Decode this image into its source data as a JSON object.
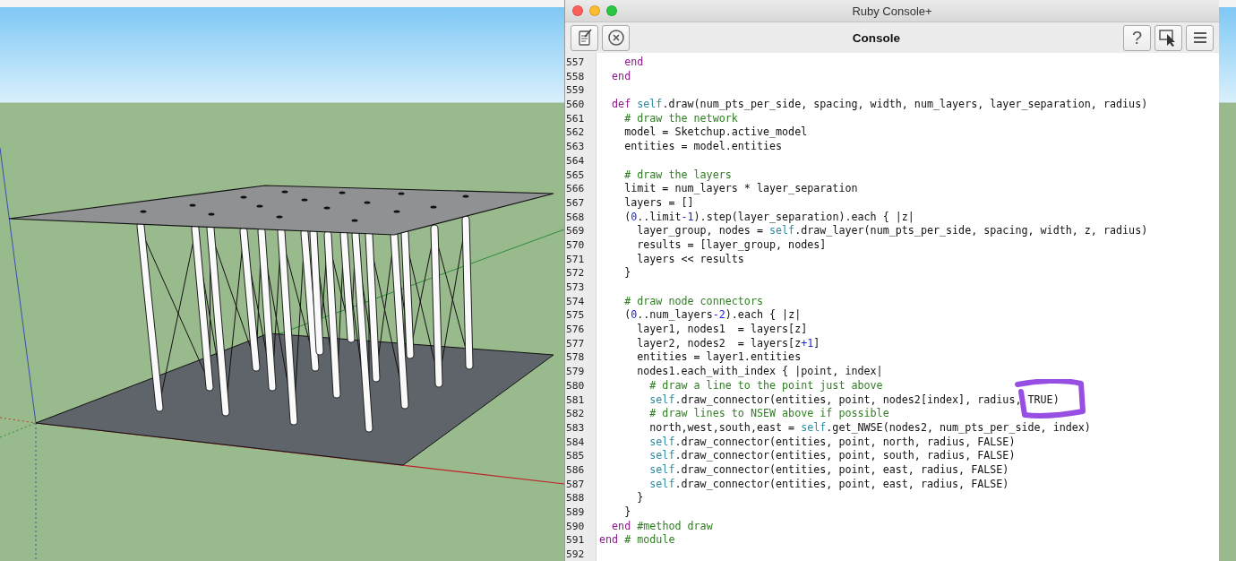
{
  "window": {
    "title": "Ruby Console+"
  },
  "toolbar": {
    "title": "Console",
    "help": "?"
  },
  "code": [
    {
      "number": "557",
      "tokens": [
        {
          "kind": "keyword",
          "text": "    end"
        }
      ]
    },
    {
      "number": "558",
      "tokens": [
        {
          "kind": "keyword",
          "text": "  end"
        }
      ]
    },
    {
      "number": "559"
    },
    {
      "number": "560",
      "tokens": [
        {
          "kind": "keyword",
          "text": "  def "
        },
        {
          "kind": "self",
          "text": "self"
        },
        {
          "kind": "plain",
          "text": ".draw(num_pts_per_side, spacing, width, num_layers, layer_separation, radius)"
        }
      ]
    },
    {
      "number": "561",
      "tokens": [
        {
          "kind": "comment",
          "text": "    # draw the network"
        }
      ]
    },
    {
      "number": "562",
      "tokens": [
        {
          "kind": "plain",
          "text": "    model = Sketchup.active_model"
        }
      ]
    },
    {
      "number": "563",
      "tokens": [
        {
          "kind": "plain",
          "text": "    entities = model.entities"
        }
      ]
    },
    {
      "number": "564"
    },
    {
      "number": "565",
      "tokens": [
        {
          "kind": "comment",
          "text": "    # draw the layers"
        }
      ]
    },
    {
      "number": "566",
      "tokens": [
        {
          "kind": "plain",
          "text": "    limit = num_layers * layer_separation"
        }
      ]
    },
    {
      "number": "567",
      "tokens": [
        {
          "kind": "plain",
          "text": "    layers = []"
        }
      ]
    },
    {
      "number": "568",
      "tokens": [
        {
          "kind": "plain",
          "text": "    ("
        },
        {
          "kind": "number",
          "text": "0"
        },
        {
          "kind": "plain",
          "text": "..limit"
        },
        {
          "kind": "number",
          "text": "-1"
        },
        {
          "kind": "plain",
          "text": ").step(layer_separation).each { |z|"
        }
      ]
    },
    {
      "number": "569",
      "tokens": [
        {
          "kind": "plain",
          "text": "      layer_group, nodes = "
        },
        {
          "kind": "self",
          "text": "self"
        },
        {
          "kind": "plain",
          "text": ".draw_layer(num_pts_per_side, spacing, width, z, radius)"
        }
      ]
    },
    {
      "number": "570",
      "tokens": [
        {
          "kind": "plain",
          "text": "      results = [layer_group, nodes]"
        }
      ]
    },
    {
      "number": "571",
      "tokens": [
        {
          "kind": "plain",
          "text": "      layers << results"
        }
      ]
    },
    {
      "number": "572",
      "tokens": [
        {
          "kind": "plain",
          "text": "    }"
        }
      ]
    },
    {
      "number": "573"
    },
    {
      "number": "574",
      "tokens": [
        {
          "kind": "comment",
          "text": "    # draw node connectors"
        }
      ]
    },
    {
      "number": "575",
      "tokens": [
        {
          "kind": "plain",
          "text": "    ("
        },
        {
          "kind": "number",
          "text": "0"
        },
        {
          "kind": "plain",
          "text": "..num_layers"
        },
        {
          "kind": "number",
          "text": "-2"
        },
        {
          "kind": "plain",
          "text": ").each { |z|"
        }
      ]
    },
    {
      "number": "576",
      "tokens": [
        {
          "kind": "plain",
          "text": "      layer1, nodes1  = layers[z]"
        }
      ]
    },
    {
      "number": "577",
      "tokens": [
        {
          "kind": "plain",
          "text": "      layer2, nodes2  = layers[z"
        },
        {
          "kind": "number",
          "text": "+1"
        },
        {
          "kind": "plain",
          "text": "]"
        }
      ]
    },
    {
      "number": "578",
      "tokens": [
        {
          "kind": "plain",
          "text": "      entities = layer1.entities"
        }
      ]
    },
    {
      "number": "579",
      "tokens": [
        {
          "kind": "plain",
          "text": "      nodes1.each_with_index { |point, index|"
        }
      ]
    },
    {
      "number": "580",
      "tokens": [
        {
          "kind": "comment",
          "text": "        # draw a line to the point just above"
        }
      ]
    },
    {
      "number": "581",
      "tokens": [
        {
          "kind": "self",
          "text": "        self"
        },
        {
          "kind": "plain",
          "text": ".draw_connector(entities, point, nodes2[index], radius, TRUE)"
        }
      ]
    },
    {
      "number": "582",
      "tokens": [
        {
          "kind": "comment",
          "text": "        # draw lines to NSEW above if possible"
        }
      ]
    },
    {
      "number": "583",
      "tokens": [
        {
          "kind": "plain",
          "text": "        north,west,south,east = "
        },
        {
          "kind": "self",
          "text": "self"
        },
        {
          "kind": "plain",
          "text": ".get_NWSE(nodes2, num_pts_per_side, index)"
        }
      ]
    },
    {
      "number": "584",
      "tokens": [
        {
          "kind": "self",
          "text": "        self"
        },
        {
          "kind": "plain",
          "text": ".draw_connector(entities, point, north, radius, FALSE)"
        }
      ]
    },
    {
      "number": "585",
      "tokens": [
        {
          "kind": "self",
          "text": "        self"
        },
        {
          "kind": "plain",
          "text": ".draw_connector(entities, point, south, radius, FALSE)"
        }
      ]
    },
    {
      "number": "586",
      "tokens": [
        {
          "kind": "self",
          "text": "        self"
        },
        {
          "kind": "plain",
          "text": ".draw_connector(entities, point, east, radius, FALSE)"
        }
      ]
    },
    {
      "number": "587",
      "tokens": [
        {
          "kind": "self",
          "text": "        self"
        },
        {
          "kind": "plain",
          "text": ".draw_connector(entities, point, east, radius, FALSE)"
        }
      ]
    },
    {
      "number": "588",
      "tokens": [
        {
          "kind": "plain",
          "text": "      }"
        }
      ]
    },
    {
      "number": "589",
      "tokens": [
        {
          "kind": "plain",
          "text": "    }"
        }
      ]
    },
    {
      "number": "590",
      "tokens": [
        {
          "kind": "keyword",
          "text": "  end "
        },
        {
          "kind": "comment",
          "text": "#method draw"
        }
      ]
    },
    {
      "number": "591",
      "tokens": [
        {
          "kind": "keyword",
          "text": "end "
        },
        {
          "kind": "comment",
          "text": "# module"
        }
      ]
    },
    {
      "number": "592"
    }
  ]
}
